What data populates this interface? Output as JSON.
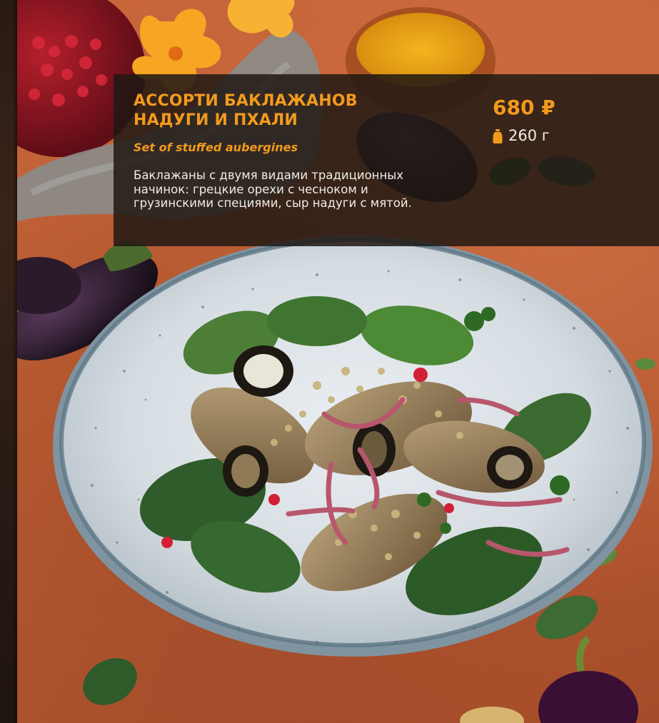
{
  "dish": {
    "title": "АССОРТИ БАКЛАЖАНОВ НАДУГИ И ПХАЛИ",
    "subtitle": "Set of stuffed aubergines",
    "description": "Баклажаны с двумя видами традиционных начинок: грецкие орехи с чесноком и грузинскими специями, сыр надуги с мятой.",
    "price": "680 ₽",
    "weight": "260 г"
  },
  "colors": {
    "accent": "#f29a1c",
    "panel": "#211814",
    "text": "#f2ece6",
    "background": "#bd5d33"
  },
  "icons": {
    "weight": "weight-icon"
  }
}
